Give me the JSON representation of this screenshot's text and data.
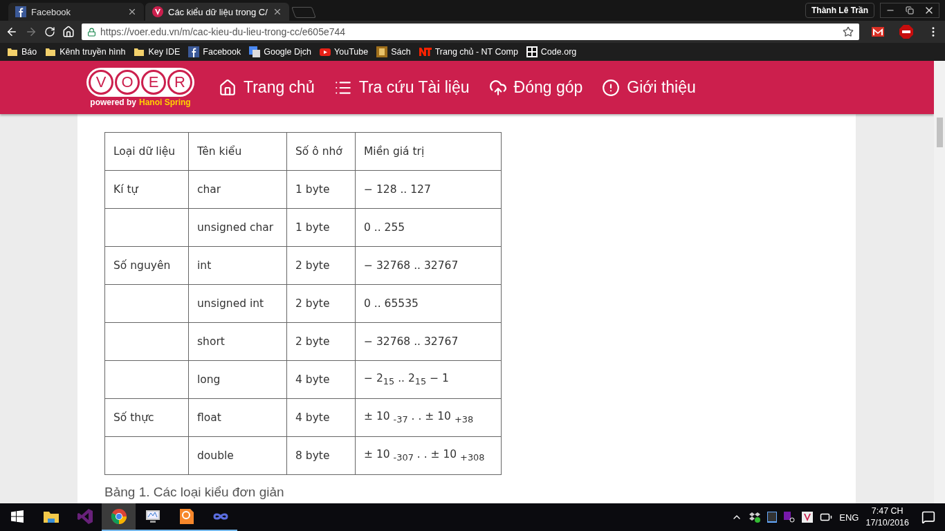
{
  "browser": {
    "tabs": [
      {
        "title": "Facebook",
        "selected": false
      },
      {
        "title": "Các kiểu dữ liệu trong C/",
        "selected": true
      }
    ],
    "profile": "Thành Lê Trần",
    "url": "https://voer.edu.vn/m/cac-kieu-du-lieu-trong-cc/e605e744",
    "bookmarks": [
      "Báo",
      "Kênh truyền hình",
      "Key IDE",
      "Facebook",
      "Google Dịch",
      "YouTube",
      "Sách",
      "Trang chủ - NT Comp",
      "Code.org"
    ]
  },
  "site": {
    "logo": {
      "letters": [
        "V",
        "O",
        "E",
        "R"
      ],
      "tagline": "powered by",
      "brand": "Hanoi Spring"
    },
    "nav": [
      "Trang chủ",
      "Tra cứu Tài liệu",
      "Đóng góp",
      "Giới thiệu"
    ]
  },
  "article": {
    "table": {
      "columns": [
        "Loại dữ liệu",
        "Tên kiểu",
        "Số ô nhớ",
        "Miền giá trị"
      ],
      "rows": [
        {
          "category": "Kí tự",
          "type": "char",
          "size": "1 byte",
          "range": "− 128 .. 127"
        },
        {
          "type": "unsigned char",
          "size": "1 byte",
          "range": "0 .. 255"
        },
        {
          "category": "Số nguyên",
          "type": "int",
          "size": "2 byte",
          "range": "− 32768 .. 32767"
        },
        {
          "type": "unsigned int",
          "size": "2 byte",
          "range": "0 .. 65535"
        },
        {
          "type": "short",
          "size": "2 byte",
          "range": "− 32768 .. 32767"
        },
        {
          "type": "long",
          "size": "4 byte",
          "range": "− 2$_{15}$ .. 2$_{15}$ − 1"
        },
        {
          "category": "Số thực",
          "type": "float",
          "size": "4 byte",
          "range": "± 10 $_{-37}$ . . ± 10 $_{+38}$"
        },
        {
          "type": "double",
          "size": "8 byte",
          "range": "± 10 $_{-307}$ . . ± 10 $_{+308}$"
        }
      ]
    },
    "caption": "Bảng 1. Các loại kiểu đơn giản"
  },
  "taskbar": {
    "apps": [
      {
        "running": false,
        "selected": false
      },
      {
        "running": false,
        "selected": false
      },
      {
        "running": true,
        "selected": true
      },
      {
        "running": true,
        "selected": false
      },
      {
        "running": true,
        "selected": false
      },
      {
        "running": true,
        "selected": false
      }
    ],
    "language": "ENG",
    "time": "7:47 CH",
    "date": "17/10/2016"
  }
}
